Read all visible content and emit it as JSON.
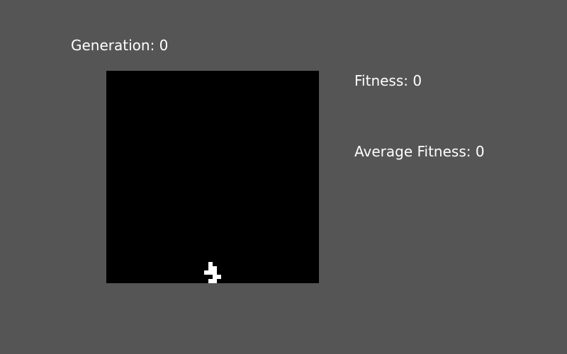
{
  "hud": {
    "generation_label": "Generation: 0",
    "fitness_label": "Fitness: 0",
    "average_fitness_label": "Average Fitness: 0"
  },
  "colors": {
    "background": "#555555",
    "board": "#000000",
    "piece": "#ffffff",
    "text": "#ffffff"
  }
}
